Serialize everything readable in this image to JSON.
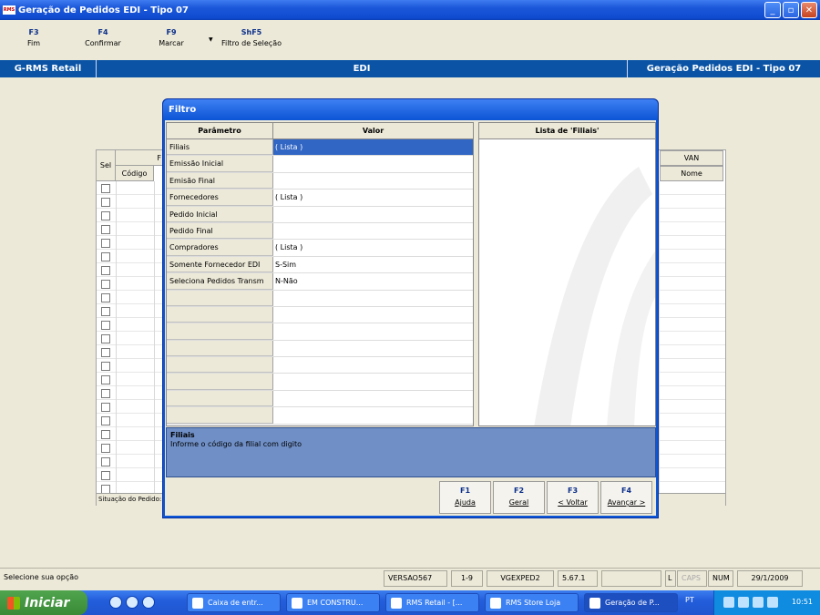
{
  "window": {
    "title": "Geração de Pedidos EDI - Tipo 07",
    "app_icon": "RMS"
  },
  "toolbar": {
    "keys": [
      {
        "key": "F3",
        "label": "Fim"
      },
      {
        "key": "F4",
        "label": "Confirmar"
      },
      {
        "key": "F9",
        "label": "Marcar"
      },
      {
        "key": "ShF5",
        "label": "Filtro de Seleção"
      }
    ]
  },
  "header": {
    "left": "G-RMS Retail",
    "center": "EDI",
    "right": "Geração Pedidos EDI - Tipo 07"
  },
  "background_grid": {
    "sel": "Sel",
    "f": "F",
    "codigo": "Código",
    "van": "VAN",
    "nome": "Nome",
    "status": "Situação do Pedido:"
  },
  "dialog": {
    "title": "Filtro",
    "col_param": "Parâmetro",
    "col_valor": "Valor",
    "list_title": "Lista de 'Filiais'",
    "rows": [
      {
        "param": "Filiais",
        "valor": "( Lista )"
      },
      {
        "param": "Emissão Inicial",
        "valor": ""
      },
      {
        "param": "Emisão Final",
        "valor": ""
      },
      {
        "param": "Fornecedores",
        "valor": "( Lista )"
      },
      {
        "param": "Pedido Inicial",
        "valor": ""
      },
      {
        "param": "Pedido Final",
        "valor": ""
      },
      {
        "param": "Compradores",
        "valor": "( Lista )"
      },
      {
        "param": "Somente Fornecedor EDI",
        "valor": "S-Sim"
      },
      {
        "param": "Seleciona Pedidos Transm",
        "valor": "N-Não"
      },
      {
        "param": "",
        "valor": ""
      },
      {
        "param": "",
        "valor": ""
      },
      {
        "param": "",
        "valor": ""
      },
      {
        "param": "",
        "valor": ""
      },
      {
        "param": "",
        "valor": ""
      },
      {
        "param": "",
        "valor": ""
      },
      {
        "param": "",
        "valor": ""
      },
      {
        "param": "",
        "valor": ""
      }
    ],
    "help_title": "Filiais",
    "help_text": "Informe o código da filial com digito",
    "buttons": [
      {
        "key": "F1",
        "label": "Ajuda"
      },
      {
        "key": "F2",
        "label": "Geral"
      },
      {
        "key": "F3",
        "label": "< Voltar"
      },
      {
        "key": "F4",
        "label": "Avançar >"
      }
    ]
  },
  "statusbar": {
    "message": "Selecione sua opção",
    "version": "VERSAO567",
    "range": "1-9",
    "program": "VGEXPED2",
    "build": "5.67.1",
    "l": "L",
    "caps": "CAPS",
    "num": "NUM",
    "date": "29/1/2009"
  },
  "taskbar": {
    "start": "Iniciar",
    "tasks": [
      "Caixa de entr...",
      "EM CONSTRU...",
      "RMS Retail - [...",
      "RMS Store Loja",
      "Geração de P..."
    ],
    "lang": "PT",
    "time": "10:51"
  }
}
